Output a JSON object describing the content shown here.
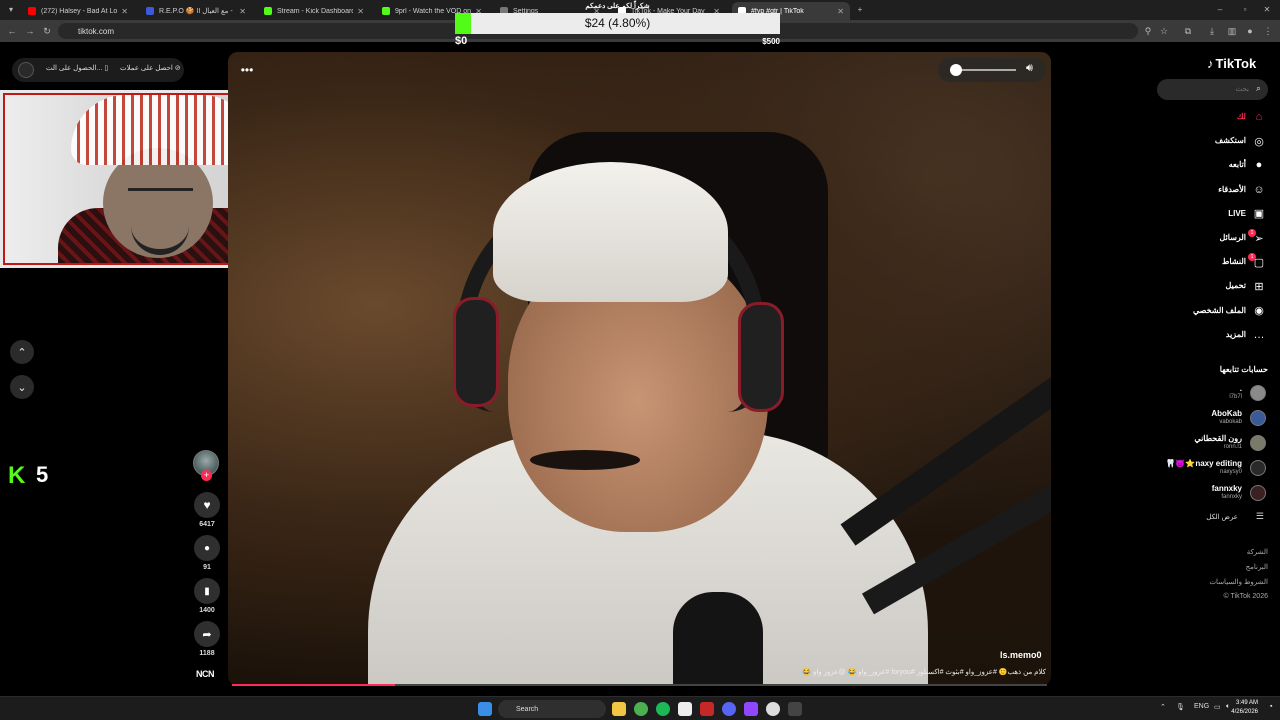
{
  "browser": {
    "tabs": [
      {
        "title": "(272) Halsey - Bad At Lov",
        "color": "#ff0000",
        "active": false
      },
      {
        "title": "R.E.P.O 🍪 II مع العيال - Rest",
        "color": "#3b5bdb",
        "active": false
      },
      {
        "title": "Stream - Kick Dashboard",
        "color": "#53fc18",
        "active": false
      },
      {
        "title": "9prl - Watch the VOD on Kick",
        "color": "#53fc18",
        "active": false
      },
      {
        "title": "Settings",
        "color": "#777777",
        "active": false
      },
      {
        "title": "TikTok - Make Your Day",
        "color": "#ffffff",
        "active": false
      },
      {
        "title": "#fyp #qtr | TikTok",
        "color": "#ffffff",
        "active": true
      }
    ],
    "url": "tiktok.com"
  },
  "donation": {
    "title": "شكراً لكم على دعمكم",
    "amount_text": "$24 (4.80%)",
    "progress_fraction": 0.048,
    "min_label": "$0",
    "max_label": "$500",
    "accent": "#53fc18"
  },
  "tiktok": {
    "promo": {
      "get_coins": "احصل على عملات",
      "get_app": "الحصول على الت..."
    },
    "logo": "TikTok",
    "search_placeholder": "بحث",
    "nav": [
      {
        "label": "لك",
        "icon": "home-icon",
        "active": true
      },
      {
        "label": "استكشف",
        "icon": "compass-icon",
        "active": false
      },
      {
        "label": "أتابعه",
        "icon": "following-avatar-icon",
        "active": false
      },
      {
        "label": "الأصدقاء",
        "icon": "friends-icon",
        "active": false
      },
      {
        "label": "LIVE",
        "icon": "live-icon",
        "active": false
      },
      {
        "label": "الرسائل",
        "icon": "messages-icon",
        "active": false,
        "badge": "1"
      },
      {
        "label": "النشاط",
        "icon": "activity-icon",
        "active": false,
        "badge": "1"
      },
      {
        "label": "تحميل",
        "icon": "upload-icon",
        "active": false
      },
      {
        "label": "الملف الشخصي",
        "icon": "profile-icon",
        "active": false
      },
      {
        "label": "المزيد",
        "icon": "more-icon",
        "active": false
      }
    ],
    "following_title": "حسابات تتابعها",
    "following": [
      {
        "name": ".",
        "handle": "l7b7l"
      },
      {
        "name": "AboKab",
        "handle": "vabokab"
      },
      {
        "name": "رون القحطاني",
        "handle": "ronn.l1"
      },
      {
        "name": "🦷😈⭐naxy editing",
        "handle": "naxysy0"
      },
      {
        "name": "fannxky",
        "handle": "fannxky"
      }
    ],
    "see_all": "عرض الكل",
    "footer": [
      "الشركة",
      "البرنامج",
      "الشروط والسياسات",
      "© TikTok 2026"
    ],
    "actions": {
      "likes": "6417",
      "comments": "91",
      "bookmarks": "1400",
      "shares": "1188"
    },
    "ncn": "NCN",
    "video": {
      "username": "ls.memo0",
      "caption": "كلام من ذهب🙂 #عزوز_واو #بثوث #اكسبلور #foryou #عزوز_واو 😂 @عزوز واو 😂",
      "progress_fraction": 0.2
    },
    "kick_count": "5"
  },
  "taskbar": {
    "search_label": "Search",
    "lang": "ENG",
    "time": "3:49 AM",
    "date": "4/26/2026"
  }
}
